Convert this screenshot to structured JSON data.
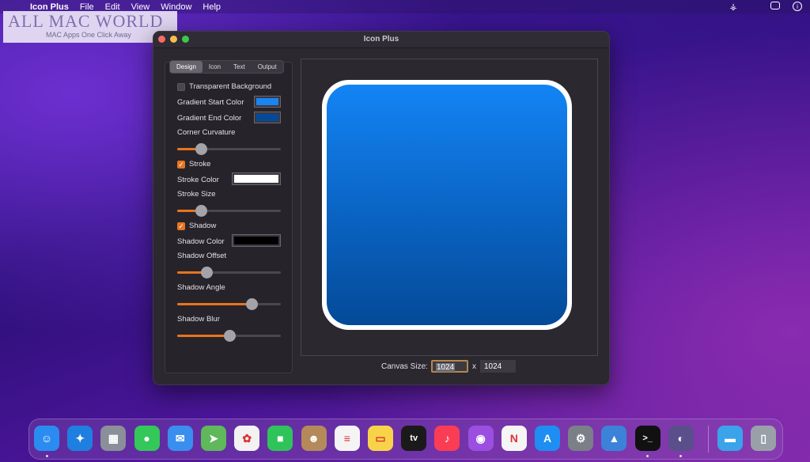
{
  "menubar": {
    "app_name": "Icon Plus",
    "items": [
      "File",
      "Edit",
      "View",
      "Window",
      "Help"
    ]
  },
  "watermark": {
    "title": "ALL MAC WORLD",
    "subtitle": "MAC Apps One Click Away"
  },
  "window": {
    "title": "Icon Plus"
  },
  "tabs": [
    "Design",
    "Icon",
    "Text",
    "Output"
  ],
  "design": {
    "transparent_background": {
      "label": "Transparent Background",
      "checked": false
    },
    "gradient_start": {
      "label": "Gradient Start Color",
      "color": "#1a84f2"
    },
    "gradient_end": {
      "label": "Gradient End Color",
      "color": "#034b9a"
    },
    "corner_curvature": {
      "label": "Corner Curvature",
      "value": 0.23
    },
    "stroke": {
      "label": "Stroke",
      "checked": true
    },
    "stroke_color": {
      "label": "Stroke Color",
      "color": "#ffffff"
    },
    "stroke_size": {
      "label": "Stroke Size",
      "value": 0.23
    },
    "shadow": {
      "label": "Shadow",
      "checked": true
    },
    "shadow_color": {
      "label": "Shadow Color",
      "color": "#000000"
    },
    "shadow_offset": {
      "label": "Shadow Offset",
      "value": 0.28
    },
    "shadow_angle": {
      "label": "Shadow Angle",
      "value": 0.72
    },
    "shadow_blur": {
      "label": "Shadow Blur",
      "value": 0.5
    }
  },
  "canvas": {
    "label": "Canvas Size:",
    "width": "1024",
    "separator": "x",
    "height": "1024"
  },
  "dock": {
    "apps": [
      {
        "name": "Finder",
        "color": "#2a8cf0",
        "glyph": "☺",
        "running": true
      },
      {
        "name": "Safari",
        "color": "#1e7fe0",
        "glyph": "✦",
        "running": false
      },
      {
        "name": "Launchpad",
        "color": "#8a8f99",
        "glyph": "▦",
        "running": false
      },
      {
        "name": "Messages",
        "color": "#34c759",
        "glyph": "●",
        "running": false
      },
      {
        "name": "Mail",
        "color": "#3a8ef0",
        "glyph": "✉",
        "running": false
      },
      {
        "name": "Maps",
        "color": "#5fb85a",
        "glyph": "➤",
        "running": false
      },
      {
        "name": "Photos",
        "color": "#f2f2f2",
        "glyph": "✿",
        "running": false
      },
      {
        "name": "FaceTime",
        "color": "#2fc45a",
        "glyph": "■",
        "running": false
      },
      {
        "name": "Contacts",
        "color": "#b48a5a",
        "glyph": "☻",
        "running": false
      },
      {
        "name": "Reminders",
        "color": "#f4f4f4",
        "glyph": "≡",
        "running": false
      },
      {
        "name": "Notes",
        "color": "#f7d34a",
        "glyph": "▭",
        "running": false
      },
      {
        "name": "Apple TV",
        "color": "#1a1a1a",
        "glyph": "tv",
        "running": false
      },
      {
        "name": "Music",
        "color": "#fa3d55",
        "glyph": "♪",
        "running": false
      },
      {
        "name": "Podcasts",
        "color": "#9b4fe0",
        "glyph": "◉",
        "running": false
      },
      {
        "name": "News",
        "color": "#f5f5f5",
        "glyph": "N",
        "running": false
      },
      {
        "name": "App Store",
        "color": "#1e8ef2",
        "glyph": "A",
        "running": false
      },
      {
        "name": "System Preferences",
        "color": "#7b7f87",
        "glyph": "⚙",
        "running": false
      },
      {
        "name": "Mountain App",
        "color": "#3c82d8",
        "glyph": "▲",
        "running": false
      },
      {
        "name": "Terminal",
        "color": "#111111",
        "glyph": ">_",
        "running": true
      },
      {
        "name": "Icon Plus",
        "color": "#5a4f8a",
        "glyph": "◐",
        "running": true
      },
      {
        "name": "Downloads Folder",
        "color": "#3aa3ea",
        "glyph": "▬",
        "running": false
      },
      {
        "name": "Trash",
        "color": "#9aa0a8",
        "glyph": "▯",
        "running": false
      }
    ]
  }
}
